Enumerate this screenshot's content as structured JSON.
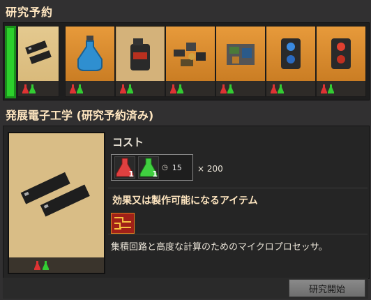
{
  "queue": {
    "title": "研究予約",
    "items": [
      {
        "icon": "electronics-icon",
        "state": "current"
      },
      {
        "icon": "blue-flask-icon",
        "state": "queued"
      },
      {
        "icon": "fuel-canister-icon",
        "state": "queued"
      },
      {
        "icon": "scrap-parts-icon",
        "state": "queued"
      },
      {
        "icon": "machinery-icon",
        "state": "queued"
      },
      {
        "icon": "blue-module-icon",
        "state": "queued"
      },
      {
        "icon": "red-module-icon",
        "state": "queued"
      }
    ]
  },
  "detail": {
    "heading": "発展電子工学 (研究予約済み)",
    "cost_label": "コスト",
    "cost": [
      {
        "icon": "red-science-pack-icon",
        "amount": "1"
      },
      {
        "icon": "green-science-pack-icon",
        "amount": "1"
      }
    ],
    "time": "15",
    "count": "× 200",
    "effects_label": "効果又は製作可能になるアイテム",
    "effect_icon": "advanced-circuit-icon",
    "description": "集積回路と高度な計算のためのマイクロプロセッサ。"
  },
  "footer": {
    "start_button": "研究開始"
  },
  "colors": {
    "accent_orange": "#e79a3b",
    "heading": "#ffe6c0",
    "progress_green": "#2cd02c"
  }
}
